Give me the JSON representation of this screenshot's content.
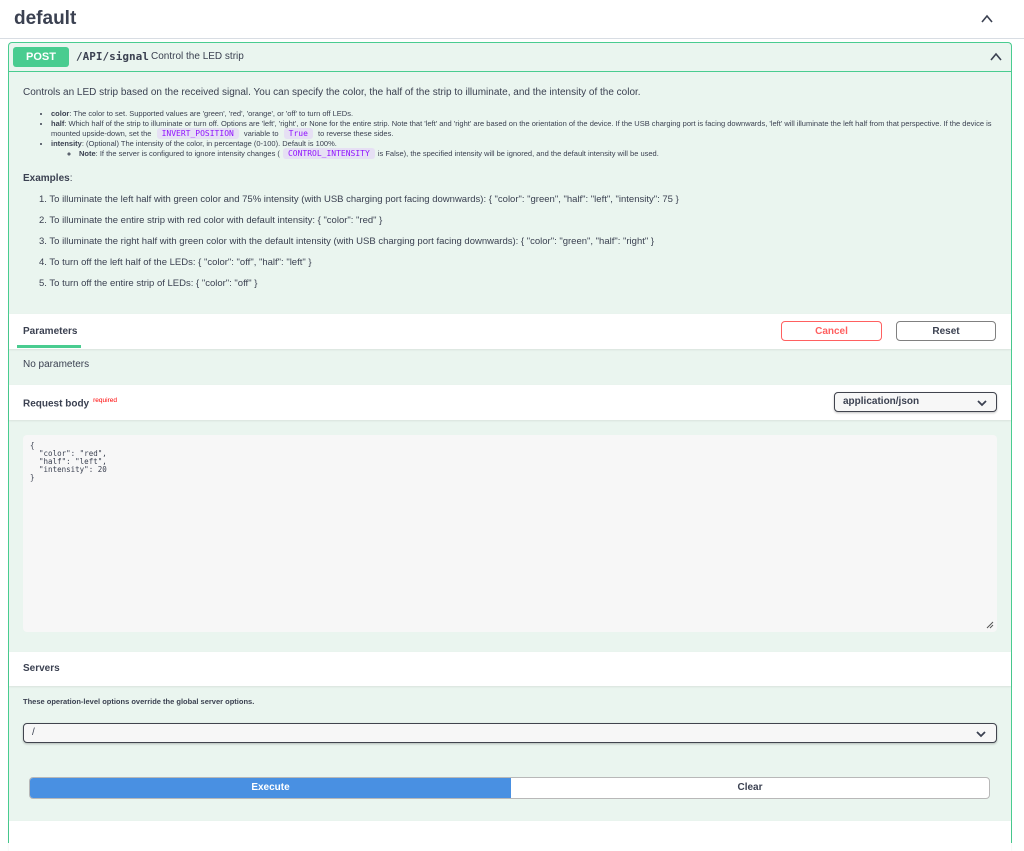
{
  "section": {
    "title": "default"
  },
  "operation": {
    "method": "POST",
    "path": "/API/signal",
    "summary": "Control the LED strip",
    "description": "Controls an LED strip based on the received signal. You can specify the color, the half of the strip to illuminate, and the intensity of the color.",
    "params_doc": {
      "color_key": "color",
      "color_text": ": The color to set. Supported values are 'green', 'red', 'orange', or 'off' to turn off LEDs.",
      "half_key": "half",
      "half_text_1": ": Which half of the strip to illuminate or turn off. Options are 'left', 'right', or None for the entire strip. Note that 'left' and 'right' are based on the orientation of the device. If the USB charging port is facing downwards, 'left' will illuminate the left half from that perspective. If the device is mounted upside-down, set the",
      "half_code_1": "INVERT_POSITION",
      "half_text_2": "variable to",
      "half_code_2": "True",
      "half_text_3": "to reverse these sides.",
      "intensity_key": "intensity",
      "intensity_text": ": (Optional) The intensity of the color, in percentage (0-100). Default is 100%.",
      "note_key": "Note",
      "note_text_1": ": If the server is configured to ignore intensity changes (",
      "note_code": "CONTROL_INTENSITY",
      "note_text_2": "is False), the specified intensity will be ignored, and the default intensity will be used."
    },
    "examples_title": "Examples",
    "examples_colon": ":",
    "examples": [
      "1. To illuminate the left half with green color and 75% intensity (with USB charging port facing downwards): { \"color\": \"green\", \"half\": \"left\", \"intensity\": 75 }",
      "2. To illuminate the entire strip with red color with default intensity: { \"color\": \"red\" }",
      "3. To illuminate the right half with green color with the default intensity (with USB charging port facing downwards): { \"color\": \"green\", \"half\": \"right\" }",
      "4. To turn off the left half of the LEDs: { \"color\": \"off\", \"half\": \"left\" }",
      "5. To turn off the entire strip of LEDs: { \"color\": \"off\" }"
    ]
  },
  "parameters": {
    "tab_label": "Parameters",
    "cancel_label": "Cancel",
    "reset_label": "Reset",
    "empty_text": "No parameters"
  },
  "request_body": {
    "label": "Request body",
    "required_label": "required",
    "content_type": "application/json",
    "body_text": "{\n  \"color\": \"red\",\n  \"half\": \"left\",\n  \"intensity\": 20\n}"
  },
  "servers": {
    "label": "Servers",
    "note": "These operation-level options override the global server options.",
    "selected": "/"
  },
  "actions": {
    "execute_label": "Execute",
    "clear_label": "Clear"
  },
  "colors": {
    "post_green": "#49cc90",
    "post_bg": "#eaf5ef",
    "execute_blue": "#4990e2",
    "cancel_red": "#ff6060"
  },
  "icons": {
    "collapse": "chevron-up-icon",
    "dropdown": "chevron-down-icon",
    "resize": "resize-handle-icon"
  }
}
